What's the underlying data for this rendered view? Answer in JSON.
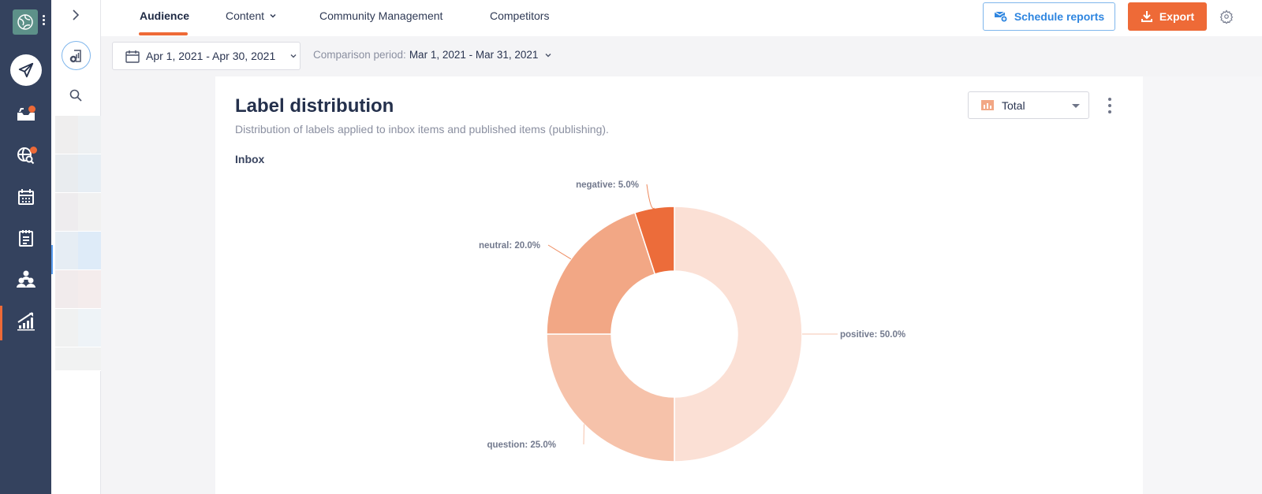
{
  "rail": {
    "items": [
      {
        "name": "publish",
        "icon": "paper-plane-icon"
      },
      {
        "name": "inbox",
        "icon": "inbox-tray-icon",
        "badge": true
      },
      {
        "name": "listening",
        "icon": "globe-search-icon",
        "badge": true
      },
      {
        "name": "calendar",
        "icon": "calendar-icon"
      },
      {
        "name": "notes",
        "icon": "notepad-icon"
      },
      {
        "name": "audience",
        "icon": "people-icon"
      },
      {
        "name": "analytics",
        "icon": "bar-chart-trend-icon",
        "active": true
      }
    ]
  },
  "nav": {
    "tabs": [
      {
        "label": "Audience",
        "active": true
      },
      {
        "label": "Content",
        "dropdown": true
      },
      {
        "label": "Community Management"
      },
      {
        "label": "Competitors"
      }
    ],
    "schedule_label": "Schedule reports",
    "export_label": "Export"
  },
  "filters": {
    "date_range": "Apr 1, 2021 - Apr 30, 2021",
    "comparison_label": "Comparison period:",
    "comparison_value": "Mar 1, 2021 - Mar 31, 2021"
  },
  "card": {
    "title": "Label distribution",
    "subtitle": "Distribution of labels applied to inbox items and published items (publishing).",
    "section": "Inbox",
    "select_value": "Total"
  },
  "colors": {
    "accent": "#ee6a37",
    "link": "#2f86e0",
    "rail_bg": "#34425e"
  },
  "chart_data": {
    "type": "pie",
    "variant": "donut",
    "title": "Inbox",
    "slices": [
      {
        "label": "positive",
        "value": 50.0,
        "display": "positive: 50.0%",
        "color": "#fbe0d5"
      },
      {
        "label": "question",
        "value": 25.0,
        "display": "question: 25.0%",
        "color": "#f6c2aa"
      },
      {
        "label": "neutral",
        "value": 20.0,
        "display": "neutral: 20.0%",
        "color": "#f2a785"
      },
      {
        "label": "negative",
        "value": 5.0,
        "display": "negative: 5.0%",
        "color": "#ec6c3a"
      }
    ],
    "start": "top",
    "direction": "clockwise",
    "legend": "none"
  }
}
